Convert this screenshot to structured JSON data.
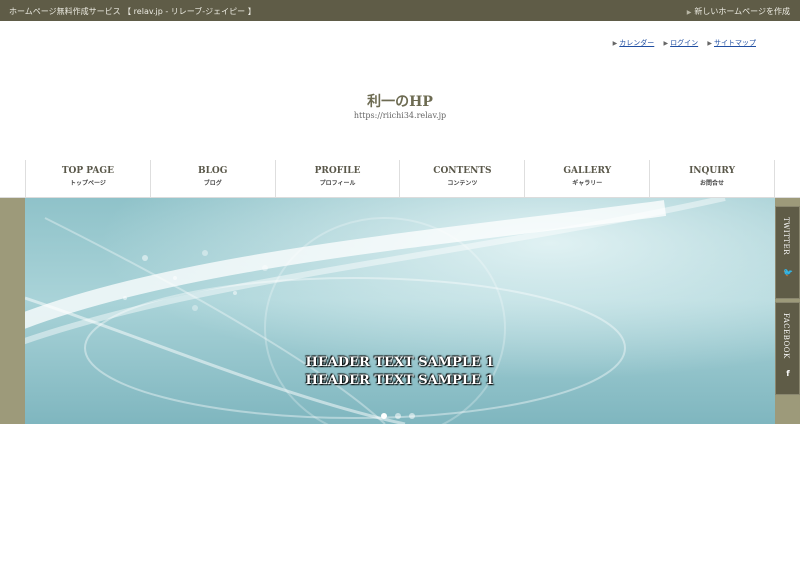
{
  "topbar": {
    "service_text": "ホームページ無料作成サービス 【 relav.jp - リレーブ-ジェイピー 】",
    "create_link": "新しいホームページを作成"
  },
  "utility_links": [
    {
      "label": "カレンダー"
    },
    {
      "label": "ログイン"
    },
    {
      "label": "サイトマップ"
    }
  ],
  "site": {
    "title": "利一のHP",
    "url": "https://riichi34.relav.jp"
  },
  "nav": [
    {
      "en": "TOP PAGE",
      "ja": "トップページ"
    },
    {
      "en": "BLOG",
      "ja": "ブログ"
    },
    {
      "en": "PROFILE",
      "ja": "プロフィール"
    },
    {
      "en": "CONTENTS",
      "ja": "コンテンツ"
    },
    {
      "en": "GALLERY",
      "ja": "ギャラリー"
    },
    {
      "en": "INQUIRY",
      "ja": "お問合せ"
    }
  ],
  "hero": {
    "line1": "HEADER TEXT SAMPLE 1",
    "line2": "HEADER TEXT SAMPLE 1",
    "slide_count": 3,
    "active_slide": 1
  },
  "social": {
    "twitter": "TWITTER",
    "facebook": "FACEBOOK"
  },
  "colors": {
    "topbar": "#5f5c47",
    "band": "#9d9a7a",
    "title": "#6d6b52",
    "link": "#1f4ea1"
  }
}
